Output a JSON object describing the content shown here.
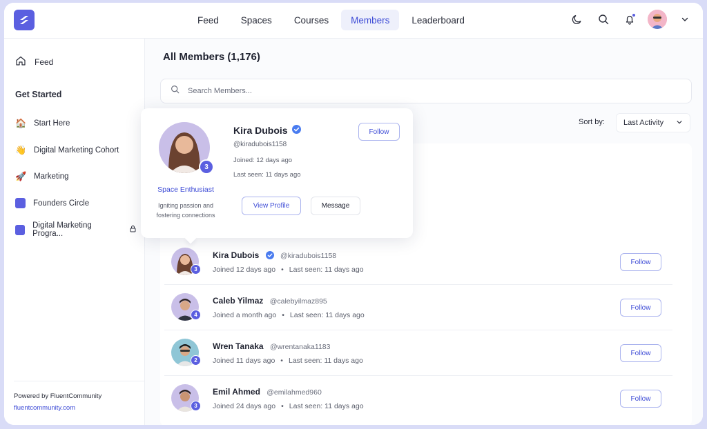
{
  "nav": {
    "items": [
      {
        "label": "Feed",
        "active": false
      },
      {
        "label": "Spaces",
        "active": false
      },
      {
        "label": "Courses",
        "active": false
      },
      {
        "label": "Members",
        "active": true
      },
      {
        "label": "Leaderboard",
        "active": false
      }
    ]
  },
  "top_icons": [
    "moon-icon",
    "search-icon",
    "bell-icon",
    "avatar",
    "chevron-down-icon"
  ],
  "sidebar": {
    "feed_label": "Feed",
    "heading": "Get Started",
    "items": [
      {
        "label": "Start Here",
        "icon": "house-emoji-icon"
      },
      {
        "label": "Digital Marketing Cohort",
        "icon": "waving-hand-emoji-icon"
      },
      {
        "label": "Marketing",
        "icon": "rocket-emoji-icon"
      },
      {
        "label": "Founders Circle",
        "icon": "purple-square-icon"
      },
      {
        "label": "Digital Marketing Progra...",
        "icon": "purple-square-icon",
        "locked": true
      }
    ],
    "powered_by": "Powered by FluentCommunity",
    "powered_link": "fluentcommunity.com"
  },
  "main": {
    "title": "All Members (1,176)",
    "search_placeholder": "Search Members...",
    "sort_label": "Sort by:",
    "sort_value": "Last Activity"
  },
  "popover": {
    "name": "Kira Dubois",
    "handle": "@kiradubois1158",
    "joined": "Joined: 12 days ago",
    "last_seen": "Last seen: 11 days ago",
    "badge": "3",
    "title": "Space Enthusiast",
    "bio": "Igniting passion and fostering connections",
    "follow_label": "Follow",
    "view_profile_label": "View Profile",
    "message_label": "Message"
  },
  "members": [
    {
      "name": "Kira Dubois",
      "handle": "@kiradubois1158",
      "verified": true,
      "joined": "Joined 12 days ago",
      "last_seen": "Last seen: 11 days ago",
      "badge": "3",
      "follow_label": "Follow"
    },
    {
      "name": "Caleb Yilmaz",
      "handle": "@calebyilmaz895",
      "verified": false,
      "joined": "Joined a month ago",
      "last_seen": "Last seen: 11 days ago",
      "badge": "4",
      "follow_label": "Follow"
    },
    {
      "name": "Wren Tanaka",
      "handle": "@wrentanaka1183",
      "verified": false,
      "joined": "Joined 11 days ago",
      "last_seen": "Last seen: 11 days ago",
      "badge": "2",
      "follow_label": "Follow"
    },
    {
      "name": "Emil Ahmed",
      "handle": "@emilahmed960",
      "verified": false,
      "joined": "Joined 24 days ago",
      "last_seen": "Last seen: 11 days ago",
      "badge": "3",
      "follow_label": "Follow"
    }
  ],
  "colors": {
    "accent": "#5b5fe0",
    "link": "#3d4bd6",
    "verified": "#4a7cf0"
  }
}
